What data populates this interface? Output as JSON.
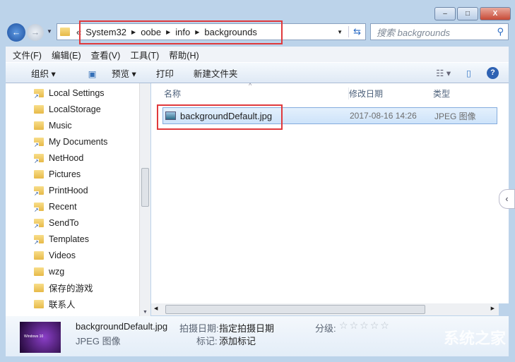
{
  "window": {
    "minimize": "–",
    "maximize": "□",
    "close": "X"
  },
  "address": {
    "overflow": "«",
    "crumbs": [
      "System32",
      "oobe",
      "info",
      "backgrounds"
    ]
  },
  "search": {
    "placeholder": "搜索 backgrounds"
  },
  "menu": [
    "文件(F)",
    "编辑(E)",
    "查看(V)",
    "工具(T)",
    "帮助(H)"
  ],
  "toolbar": {
    "organize": "组织",
    "preview": "预览",
    "print": "打印",
    "new_folder": "新建文件夹"
  },
  "nav": [
    {
      "label": "Local Settings",
      "link": true
    },
    {
      "label": "LocalStorage",
      "link": false
    },
    {
      "label": "Music",
      "link": false
    },
    {
      "label": "My Documents",
      "link": true
    },
    {
      "label": "NetHood",
      "link": true
    },
    {
      "label": "Pictures",
      "link": false
    },
    {
      "label": "PrintHood",
      "link": true
    },
    {
      "label": "Recent",
      "link": true
    },
    {
      "label": "SendTo",
      "link": true
    },
    {
      "label": "Templates",
      "link": true
    },
    {
      "label": "Videos",
      "link": false
    },
    {
      "label": "wzg",
      "link": false
    },
    {
      "label": "保存的游戏",
      "link": false
    },
    {
      "label": "联系人",
      "link": false
    }
  ],
  "columns": {
    "name": "名称",
    "modified": "修改日期",
    "type": "类型"
  },
  "files": [
    {
      "name": "backgroundDefault.jpg",
      "modified": "2017-08-16 14:26",
      "type": "JPEG 图像"
    }
  ],
  "details": {
    "name": "backgroundDefault.jpg",
    "type": "JPEG 图像",
    "date_label": "拍摄日期:",
    "date_value": "指定拍摄日期",
    "tags_label": "标记:",
    "tags_value": "添加标记",
    "rating_label": "分级:",
    "rating": 0,
    "thumb_text": "Windows 10"
  },
  "watermark": "系统之家",
  "colors": {
    "highlight": "#e0393c",
    "selection": "#cde3fa"
  }
}
